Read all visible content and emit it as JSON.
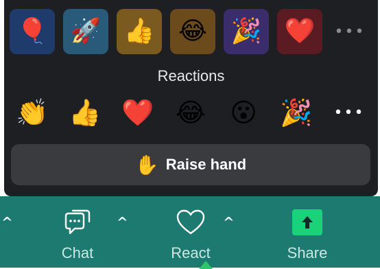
{
  "recent": {
    "tiles": [
      {
        "emoji": "🎈",
        "icon": "balloon-icon",
        "bg": "#1f3b6b"
      },
      {
        "emoji": "🚀",
        "icon": "rocket-icon",
        "bg": "#2a5a7a"
      },
      {
        "emoji": "👍",
        "icon": "thumbs-up-icon",
        "bg": "#7a5a1e"
      },
      {
        "emoji": "😂",
        "icon": "tears-of-joy-icon",
        "bg": "#6b4a1c"
      },
      {
        "emoji": "🎉",
        "icon": "party-popper-icon",
        "bg": "#3b2d6b"
      },
      {
        "emoji": "❤️",
        "icon": "heart-icon",
        "bg": "#5a1c22"
      }
    ],
    "more": "•••"
  },
  "reactions": {
    "title": "Reactions",
    "items": [
      {
        "emoji": "👏",
        "icon": "clapping-hands-icon"
      },
      {
        "emoji": "👍",
        "icon": "thumbs-up-icon"
      },
      {
        "emoji": "❤️",
        "icon": "heart-icon"
      },
      {
        "emoji": "😂",
        "icon": "tears-of-joy-icon"
      },
      {
        "emoji": "😮",
        "icon": "surprised-face-icon"
      },
      {
        "emoji": "🎉",
        "icon": "party-popper-icon"
      }
    ],
    "more": "•••"
  },
  "raise_hand": {
    "emoji": "✋",
    "label": "Raise hand"
  },
  "toolbar": {
    "left_caret": "^",
    "chat": {
      "label": "Chat",
      "caret": "^"
    },
    "react": {
      "label": "React",
      "caret": "^"
    },
    "share": {
      "label": "Share"
    }
  },
  "colors": {
    "popup_bg": "#1e1f22",
    "toolbar_bg": "#1c7a70",
    "share_accent": "#1ad27a"
  }
}
